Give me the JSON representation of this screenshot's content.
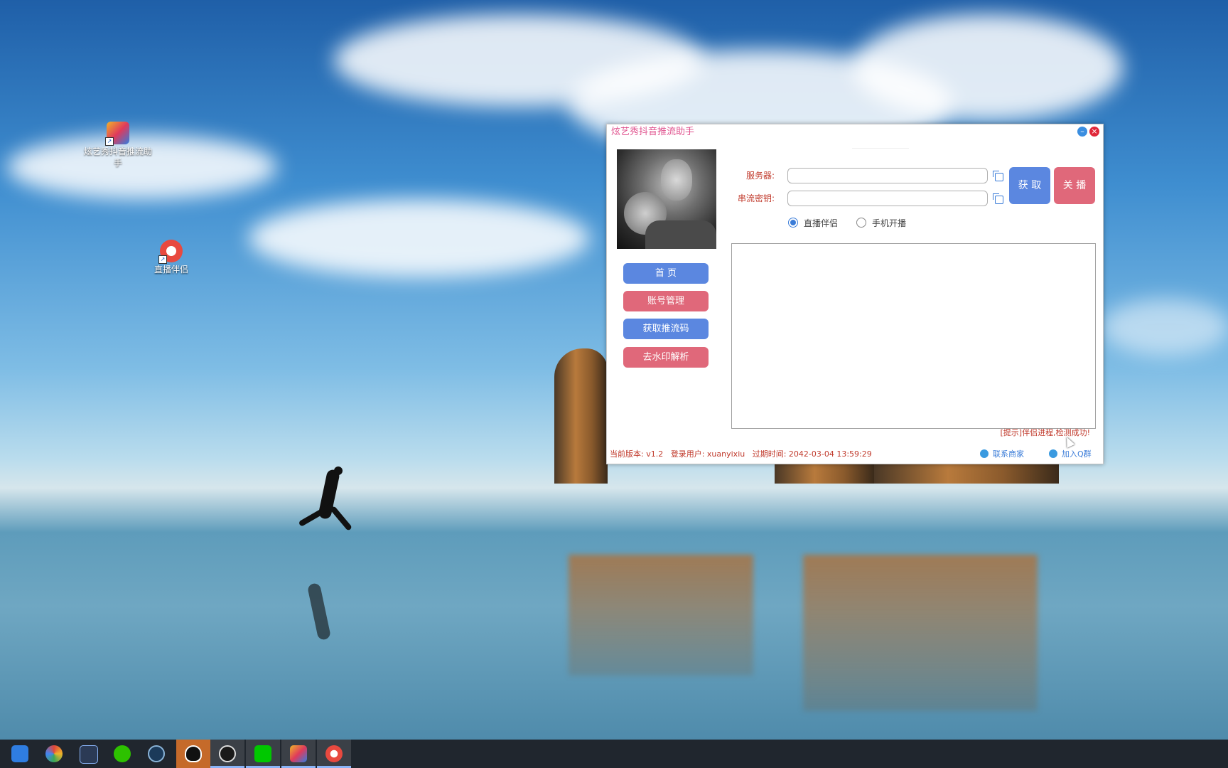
{
  "desktop": {
    "icons": [
      {
        "label": "炫艺秀抖音推流助手",
        "icon": "app-shortcut-icon"
      },
      {
        "label": "直播伴侣",
        "icon": "live-companion-icon"
      }
    ]
  },
  "app": {
    "title": "炫艺秀抖音推流助手",
    "controls": {
      "minimize": "–",
      "close": "×"
    },
    "nav": {
      "home": "首 页",
      "account": "账号管理",
      "get_stream_code": "获取推流码",
      "watermark": "去水印解析"
    },
    "form": {
      "server_label": "服务器:",
      "server_value": "",
      "key_label": "串流密钥:",
      "key_value": ""
    },
    "buttons": {
      "get": "获 取",
      "stop": "关 播"
    },
    "radios": {
      "companion": "直播伴侣",
      "mobile": "手机开播",
      "selected": "companion"
    },
    "hint": "[提示]伴侣进程,检测成功!",
    "status": {
      "version": "当前版本: v1.2",
      "user": "登录用户: xuanyixiu",
      "expiry": "过期时间: 2042-03-04 13:59:29"
    },
    "links": {
      "contact": "联系商家",
      "join_group": "加入Q群"
    }
  },
  "taskbar": {
    "items": [
      "pinned-bird-icon",
      "browser-icon",
      "notes-icon",
      "wechat-icon",
      "steam-icon",
      "qq-icon",
      "obs-icon",
      "iqiyi-icon",
      "app-icon",
      "live-companion-icon"
    ]
  }
}
